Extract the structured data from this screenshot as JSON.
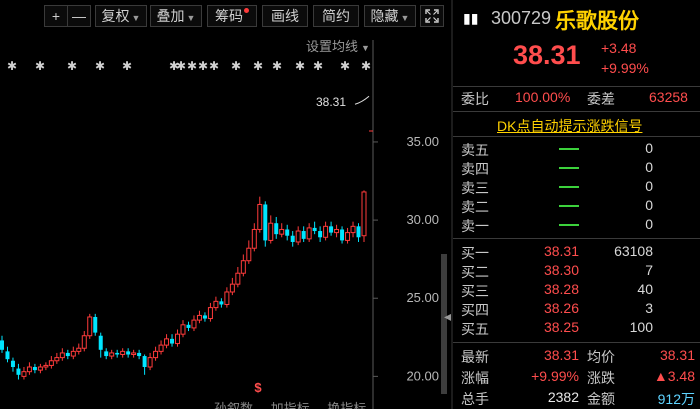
{
  "toolbar": {
    "plus": "+",
    "minus": "—",
    "adjust": "复权",
    "overlay": "叠加",
    "chips": "筹码",
    "draw": "画线",
    "simple": "简约",
    "hide": "隐藏",
    "expand_icon": "expand-icon",
    "colors": {
      "border": "#3a3a3a",
      "notify_dot": "#ff3b3b"
    }
  },
  "chart": {
    "ma_setting_label": "设置均线",
    "price_marker": "38.31",
    "signal_marker": "$",
    "axis_ticks": [
      "35.00",
      "30.00",
      "25.00",
      "20.00"
    ],
    "indicator_tabs": [
      "孙叙数",
      "加指标",
      "换指标"
    ],
    "colors": {
      "up": "#ff3b3b",
      "down": "#00e5ff",
      "axis": "#5a5a5a",
      "signal": "#ff4d4d"
    }
  },
  "chart_data": {
    "type": "candlestick",
    "ylim": [
      19,
      40.5
    ],
    "y_ticks": [
      35,
      30,
      25,
      20
    ],
    "last_price": 38.31,
    "candles": [
      {
        "o": 22.3,
        "c": 21.7,
        "h": 22.6,
        "l": 21.5
      },
      {
        "o": 21.6,
        "c": 21.1,
        "h": 21.9,
        "l": 20.9
      },
      {
        "o": 21.0,
        "c": 20.6,
        "h": 21.2,
        "l": 20.3
      },
      {
        "o": 20.5,
        "c": 20.1,
        "h": 20.8,
        "l": 19.8
      },
      {
        "o": 20.0,
        "c": 20.3,
        "h": 20.6,
        "l": 19.8
      },
      {
        "o": 20.3,
        "c": 20.6,
        "h": 20.9,
        "l": 20.1
      },
      {
        "o": 20.6,
        "c": 20.4,
        "h": 20.8,
        "l": 20.2
      },
      {
        "o": 20.4,
        "c": 20.6,
        "h": 20.8,
        "l": 20.2
      },
      {
        "o": 20.6,
        "c": 20.7,
        "h": 20.9,
        "l": 20.4
      },
      {
        "o": 20.7,
        "c": 21.0,
        "h": 21.3,
        "l": 20.5
      },
      {
        "o": 21.0,
        "c": 21.2,
        "h": 21.5,
        "l": 20.8
      },
      {
        "o": 21.2,
        "c": 21.5,
        "h": 21.8,
        "l": 21.0
      },
      {
        "o": 21.5,
        "c": 21.3,
        "h": 21.7,
        "l": 21.1
      },
      {
        "o": 21.3,
        "c": 21.6,
        "h": 21.9,
        "l": 21.1
      },
      {
        "o": 21.6,
        "c": 21.8,
        "h": 22.1,
        "l": 21.4
      },
      {
        "o": 21.8,
        "c": 22.6,
        "h": 22.9,
        "l": 21.6
      },
      {
        "o": 22.6,
        "c": 23.8,
        "h": 24.0,
        "l": 22.4
      },
      {
        "o": 23.8,
        "c": 22.8,
        "h": 24.0,
        "l": 22.6
      },
      {
        "o": 22.6,
        "c": 21.7,
        "h": 22.8,
        "l": 21.2
      },
      {
        "o": 21.6,
        "c": 21.3,
        "h": 21.8,
        "l": 21.1
      },
      {
        "o": 21.3,
        "c": 21.5,
        "h": 21.7,
        "l": 21.1
      },
      {
        "o": 21.5,
        "c": 21.4,
        "h": 21.7,
        "l": 21.2
      },
      {
        "o": 21.4,
        "c": 21.6,
        "h": 21.8,
        "l": 21.2
      },
      {
        "o": 21.6,
        "c": 21.4,
        "h": 21.8,
        "l": 21.2
      },
      {
        "o": 21.4,
        "c": 21.5,
        "h": 21.7,
        "l": 21.2
      },
      {
        "o": 21.5,
        "c": 21.3,
        "h": 21.7,
        "l": 21.1
      },
      {
        "o": 21.3,
        "c": 20.6,
        "h": 21.4,
        "l": 20.1
      },
      {
        "o": 20.6,
        "c": 21.2,
        "h": 21.5,
        "l": 20.4
      },
      {
        "o": 21.2,
        "c": 21.6,
        "h": 21.9,
        "l": 21.0
      },
      {
        "o": 21.6,
        "c": 22.0,
        "h": 22.3,
        "l": 21.4
      },
      {
        "o": 22.0,
        "c": 22.4,
        "h": 22.7,
        "l": 21.8
      },
      {
        "o": 22.4,
        "c": 22.1,
        "h": 22.7,
        "l": 21.9
      },
      {
        "o": 22.1,
        "c": 22.7,
        "h": 23.0,
        "l": 21.9
      },
      {
        "o": 22.7,
        "c": 23.3,
        "h": 23.6,
        "l": 22.5
      },
      {
        "o": 23.3,
        "c": 23.1,
        "h": 23.5,
        "l": 22.9
      },
      {
        "o": 23.1,
        "c": 23.6,
        "h": 23.9,
        "l": 22.9
      },
      {
        "o": 23.6,
        "c": 23.9,
        "h": 24.2,
        "l": 23.4
      },
      {
        "o": 23.9,
        "c": 23.7,
        "h": 24.1,
        "l": 23.5
      },
      {
        "o": 23.7,
        "c": 24.4,
        "h": 24.7,
        "l": 23.5
      },
      {
        "o": 24.4,
        "c": 24.8,
        "h": 25.1,
        "l": 24.2
      },
      {
        "o": 24.8,
        "c": 24.6,
        "h": 25.0,
        "l": 24.4
      },
      {
        "o": 24.6,
        "c": 25.4,
        "h": 25.7,
        "l": 24.4
      },
      {
        "o": 25.4,
        "c": 25.9,
        "h": 26.3,
        "l": 25.2
      },
      {
        "o": 25.9,
        "c": 26.6,
        "h": 27.0,
        "l": 25.7
      },
      {
        "o": 26.6,
        "c": 27.4,
        "h": 27.8,
        "l": 26.4
      },
      {
        "o": 27.4,
        "c": 28.2,
        "h": 28.7,
        "l": 27.2
      },
      {
        "o": 28.2,
        "c": 29.4,
        "h": 29.8,
        "l": 28.0
      },
      {
        "o": 29.4,
        "c": 31.0,
        "h": 31.5,
        "l": 29.2
      },
      {
        "o": 31.0,
        "c": 28.7,
        "h": 31.2,
        "l": 28.3
      },
      {
        "o": 28.7,
        "c": 29.8,
        "h": 30.3,
        "l": 28.5
      },
      {
        "o": 29.8,
        "c": 29.1,
        "h": 30.2,
        "l": 28.8
      },
      {
        "o": 29.1,
        "c": 29.4,
        "h": 29.8,
        "l": 28.9
      },
      {
        "o": 29.4,
        "c": 29.0,
        "h": 29.7,
        "l": 28.7
      },
      {
        "o": 29.0,
        "c": 28.6,
        "h": 29.3,
        "l": 28.3
      },
      {
        "o": 28.6,
        "c": 29.3,
        "h": 29.6,
        "l": 28.4
      },
      {
        "o": 29.3,
        "c": 28.8,
        "h": 29.6,
        "l": 28.6
      },
      {
        "o": 28.8,
        "c": 29.5,
        "h": 29.8,
        "l": 28.6
      },
      {
        "o": 29.5,
        "c": 29.3,
        "h": 29.9,
        "l": 29.1
      },
      {
        "o": 29.3,
        "c": 28.9,
        "h": 29.6,
        "l": 28.6
      },
      {
        "o": 28.9,
        "c": 29.6,
        "h": 29.9,
        "l": 28.7
      },
      {
        "o": 29.6,
        "c": 29.2,
        "h": 29.9,
        "l": 29.0
      },
      {
        "o": 29.2,
        "c": 29.4,
        "h": 29.7,
        "l": 28.9
      },
      {
        "o": 29.4,
        "c": 28.7,
        "h": 29.6,
        "l": 28.5
      },
      {
        "o": 28.7,
        "c": 29.2,
        "h": 29.5,
        "l": 28.5
      },
      {
        "o": 29.2,
        "c": 29.6,
        "h": 29.9,
        "l": 28.9
      },
      {
        "o": 29.6,
        "c": 28.9,
        "h": 29.8,
        "l": 28.6
      },
      {
        "o": 29.0,
        "c": 31.8,
        "h": 31.9,
        "l": 28.6
      }
    ]
  },
  "quote": {
    "code": "300729",
    "name": "乐歌股份",
    "price": "38.31",
    "change": "+3.48",
    "change_pct": "+9.99%",
    "bars_icon": "bars-icon",
    "commission_ratio_label": "委比",
    "commission_ratio": "100.00%",
    "commission_diff_label": "委差",
    "commission_diff": "63258",
    "dk_link": "DK点自动提示涨跌信号"
  },
  "order_book": {
    "asks": [
      {
        "label": "卖五",
        "price": "—",
        "volume": "0"
      },
      {
        "label": "卖四",
        "price": "—",
        "volume": "0"
      },
      {
        "label": "卖三",
        "price": "—",
        "volume": "0"
      },
      {
        "label": "卖二",
        "price": "—",
        "volume": "0"
      },
      {
        "label": "卖一",
        "price": "—",
        "volume": "0"
      }
    ],
    "bids": [
      {
        "label": "买一",
        "price": "38.31",
        "volume": "63108"
      },
      {
        "label": "买二",
        "price": "38.30",
        "volume": "7"
      },
      {
        "label": "买三",
        "price": "38.28",
        "volume": "40"
      },
      {
        "label": "买四",
        "price": "38.26",
        "volume": "3"
      },
      {
        "label": "买五",
        "price": "38.25",
        "volume": "100"
      }
    ]
  },
  "stats": [
    {
      "l1": "最新",
      "v1": "38.31",
      "l2": "均价",
      "v2": "38.31"
    },
    {
      "l1": "涨幅",
      "v1": "+9.99%",
      "l2": "涨跌",
      "v2": "▲3.48"
    },
    {
      "l1": "总手",
      "v1": "2382",
      "l2": "金额",
      "v2": "912万"
    }
  ]
}
